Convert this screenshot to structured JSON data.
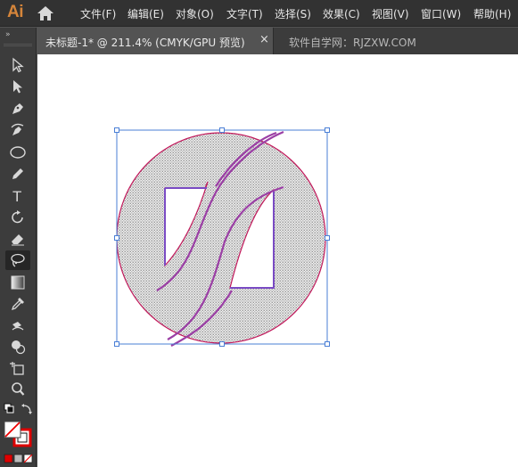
{
  "app": {
    "logo": "Ai"
  },
  "menu": [
    {
      "label": "文件(F)"
    },
    {
      "label": "编辑(E)"
    },
    {
      "label": "对象(O)"
    },
    {
      "label": "文字(T)"
    },
    {
      "label": "选择(S)"
    },
    {
      "label": "效果(C)"
    },
    {
      "label": "视图(V)"
    },
    {
      "label": "窗口(W)"
    },
    {
      "label": "帮助(H)"
    }
  ],
  "tab": {
    "title": "未标题-1* @ 211.4% (CMYK/GPU 预览)",
    "close": "×",
    "watermark": "软件自学网：RJZXW.COM"
  },
  "toolbar": {
    "collapse": "»",
    "tools": [
      {
        "icon": "selection-icon"
      },
      {
        "icon": "direct-selection-icon"
      },
      {
        "icon": "pen-icon"
      },
      {
        "icon": "curvature-icon"
      },
      {
        "icon": "ellipse-icon"
      },
      {
        "icon": "pencil-icon"
      },
      {
        "icon": "type-icon",
        "glyph": "T"
      },
      {
        "icon": "rotate-icon"
      },
      {
        "icon": "eraser-icon"
      },
      {
        "icon": "lasso-icon",
        "selected": true
      },
      {
        "icon": "gradient-icon"
      },
      {
        "icon": "eyedropper-icon"
      },
      {
        "icon": "blend-icon"
      },
      {
        "icon": "shape-builder-icon"
      },
      {
        "icon": "artboard-icon"
      },
      {
        "icon": "zoom-icon"
      }
    ]
  },
  "colors": {
    "menubar": "#323232",
    "toolbar": "#3c3c3c",
    "canvas": "#ffffff",
    "bounding_box": "#4a7fd6",
    "path_stroke": "#8e3aa6",
    "ellipse_stroke": "#c2185b",
    "brand": "#d5853a"
  }
}
